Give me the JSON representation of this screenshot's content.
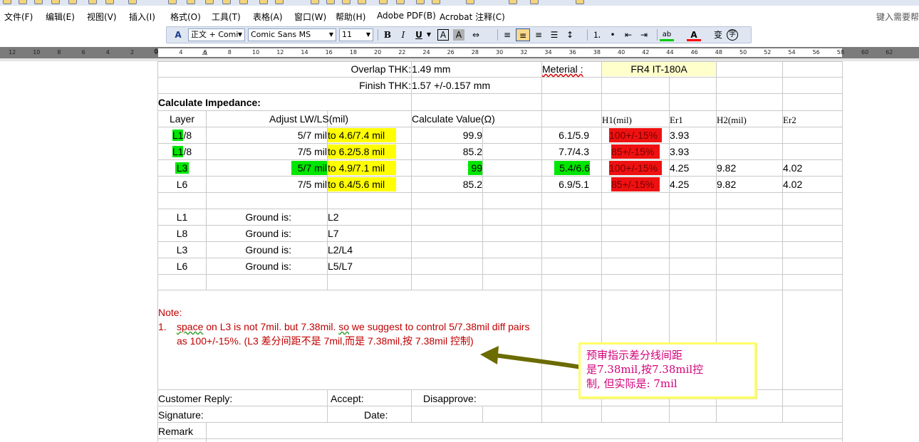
{
  "menubar": {
    "items": [
      "文件(F)",
      "编辑(E)",
      "视图(V)",
      "插入(I)",
      "格式(O)",
      "工具(T)",
      "表格(A)",
      "窗口(W)",
      "帮助(H)",
      "Adobe PDF(B)",
      "Acrobat 注释(C)"
    ],
    "help_search": "键入需要帮"
  },
  "format_toolbar": {
    "style": "正文 + Comi",
    "font": "Comic Sans MS",
    "size": "11",
    "bold": "B",
    "italic": "I",
    "underline": "U",
    "char_border": "A",
    "char_shade": "A",
    "phonetic": "变",
    "enclose": "字"
  },
  "ruler": {
    "ticks": [
      "12",
      "10",
      "8",
      "6",
      "4",
      "2",
      "2",
      "4",
      "6",
      "8",
      "10",
      "12",
      "14",
      "16",
      "18",
      "20",
      "22",
      "24",
      "26",
      "28",
      "30",
      "32",
      "34",
      "36",
      "38",
      "40",
      "42",
      "44",
      "46",
      "48",
      "50",
      "52",
      "54",
      "56",
      "58",
      "60",
      "62"
    ]
  },
  "doc": {
    "overlap_label": "Overlap THK:",
    "overlap_value": "1.49 mm",
    "material_label": "Meterial :",
    "material_value": "FR4 IT-180A",
    "finish_label": "Finish THK:",
    "finish_value": "1.57 +/-0.157 mm",
    "calc_title": "Calculate Impedance:",
    "headers": {
      "layer": "Layer",
      "adjust": "Adjust LW/LS(mil)",
      "calc_value": "Calculate Value(Ω)",
      "h1": "H1(mil)",
      "er1": "Er1",
      "h2": "H2(mil)",
      "er2": "Er2"
    },
    "rows": [
      {
        "layer_hl": "L1",
        "layer_rest": "/8",
        "lwls": "5/7 mil",
        "adjust": "to  4.6/7.4 mil",
        "calc": "99.9",
        "h1": "6.1/5.9",
        "imp": "100+/-15%",
        "er1": "3.93",
        "h2": "",
        "er2": ""
      },
      {
        "layer_hl": "L1",
        "layer_rest": "/8",
        "lwls": "7/5 mil",
        "adjust": "to  6.2/5.8 mil",
        "calc": "85.2",
        "h1": "7.7/4.3",
        "imp": "85+/-15%",
        "er1": "3.93",
        "h2": "",
        "er2": ""
      },
      {
        "layer_hl": "L3",
        "layer_rest": "",
        "lwls": "5/7 mil",
        "adjust": "to  4.9/7.1 mil",
        "calc": "99",
        "h1": "5.4/6.6",
        "imp": "100+/-15%",
        "er1": "4.25",
        "h2": "9.82",
        "er2": "4.02"
      },
      {
        "layer_hl": "",
        "layer_rest": "L6",
        "lwls": "7/5 mil",
        "adjust": "to  6.4/5.6 mil",
        "calc": "85.2",
        "h1": "6.9/5.1",
        "imp": "85+/-15%",
        "er1": "4.25",
        "h2": "9.82",
        "er2": "4.02"
      }
    ],
    "ground": [
      {
        "layer": "L1",
        "label": "Ground is:",
        "ref": "L2"
      },
      {
        "layer": "L8",
        "label": "Ground is:",
        "ref": "L7"
      },
      {
        "layer": "L3",
        "label": "Ground is:",
        "ref": "L2/L4"
      },
      {
        "layer": "L6",
        "label": "Ground is:",
        "ref": "L5/L7"
      }
    ],
    "note": {
      "title": "Note:",
      "num": "1.",
      "w1": "space",
      "t1": " on L3 is not 7mil.  but 7.38mil. ",
      "w2": "so",
      "t2": " we suggest to control 5/7.38mil diff pairs as 100+/-15%.  (L3 差分间距不是 7mil,而是 7.38mil,按 7.38mil 控制)"
    },
    "customer_reply": "Customer Reply:",
    "accept": "Accept:",
    "disapprove": "Disapprove:",
    "signature": "Signature:",
    "date": "Date:",
    "remark": "Remark"
  },
  "callout": {
    "text": "预审指示差分线间距\n是7.38mil,按7.38mil控\n制, 但实际是: 7mil"
  },
  "colors": {
    "highlight_yellow": "#ffff00",
    "highlight_green": "#00e600",
    "highlight_red": "#ee1111",
    "note_red": "#c00000",
    "callout_text": "#d4007a",
    "arrow": "#6b6b00"
  }
}
